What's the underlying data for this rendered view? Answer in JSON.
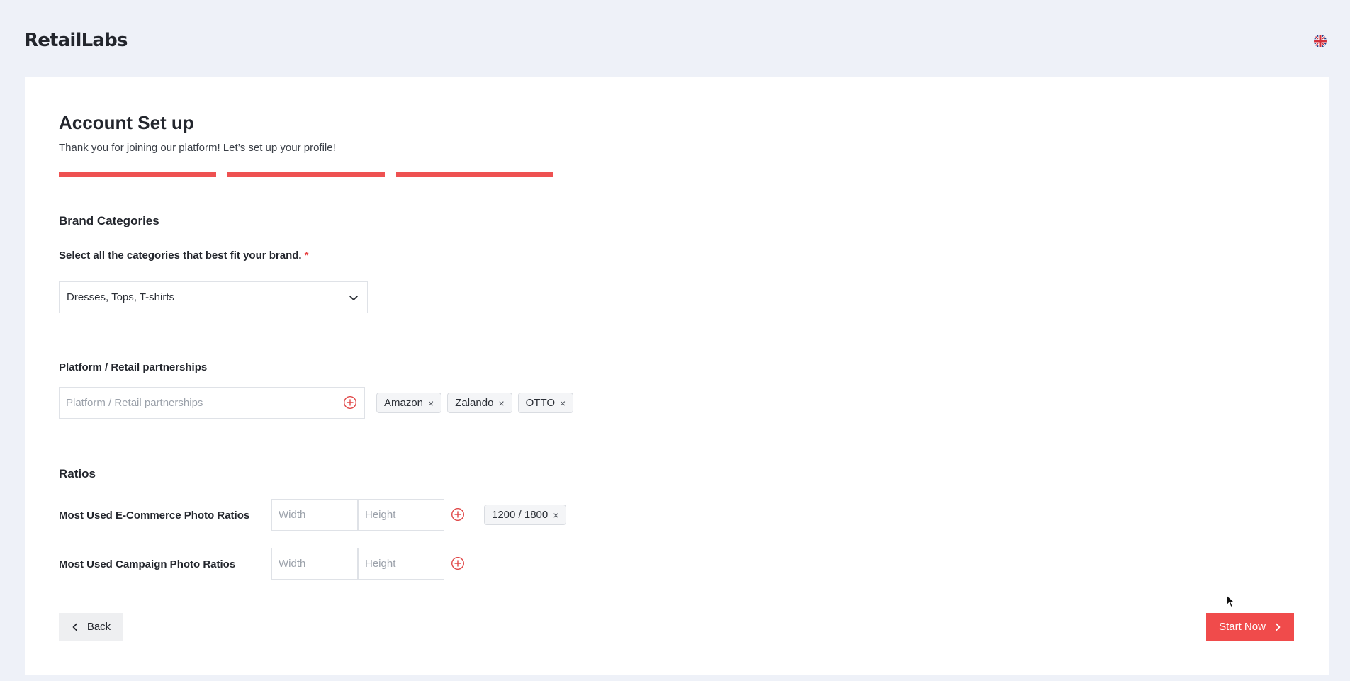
{
  "header": {
    "logo": "RetailLabs",
    "language_icon": "uk-flag-icon"
  },
  "page": {
    "title": "Account Set up",
    "subtitle": "Thank you for joining our platform! Let’s set up your profile!",
    "progress": {
      "steps_total": 3,
      "steps_completed": 3
    }
  },
  "brand_categories": {
    "heading": "Brand Categories",
    "label": "Select all the categories that best fit your brand.",
    "required_mark": "*",
    "selected_value": "Dresses, Tops, T-shirts"
  },
  "partnerships": {
    "label": "Platform / Retail partnerships",
    "placeholder": "Platform / Retail partnerships",
    "tags": [
      "Amazon",
      "Zalando",
      "OTTO"
    ]
  },
  "ratios": {
    "heading": "Ratios",
    "ecommerce": {
      "label": "Most Used E-Commerce Photo Ratios",
      "width_placeholder": "Width",
      "height_placeholder": "Height",
      "tags": [
        "1200 / 1800"
      ]
    },
    "campaign": {
      "label": "Most Used Campaign Photo Ratios",
      "width_placeholder": "Width",
      "height_placeholder": "Height",
      "tags": []
    }
  },
  "actions": {
    "back_label": "Back",
    "start_label": "Start Now"
  },
  "colors": {
    "accent": "#f04b4b",
    "progress": "#ee5151",
    "background": "#eef1f8"
  },
  "remove_glyph": "×"
}
